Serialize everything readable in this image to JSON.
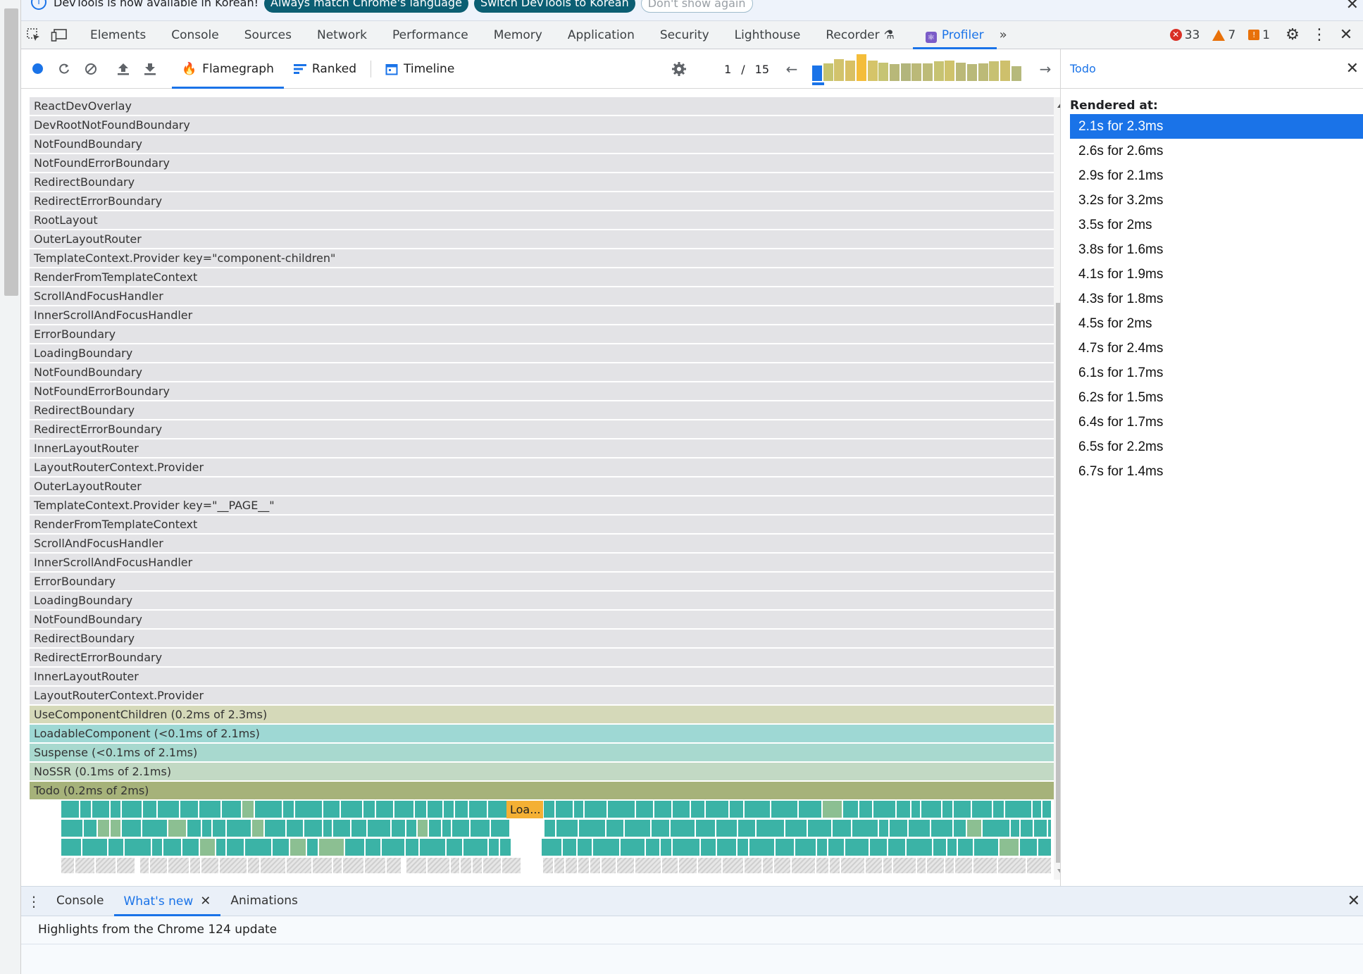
{
  "infobar": {
    "text": "DevTools is now available in Korean!",
    "match_language": "Always match Chrome's language",
    "switch_language": "Switch DevTools to Korean",
    "dont_show": "Don't show again"
  },
  "main_tabs": [
    {
      "name": "tab-elements",
      "label": "Elements"
    },
    {
      "name": "tab-console",
      "label": "Console"
    },
    {
      "name": "tab-sources",
      "label": "Sources"
    },
    {
      "name": "tab-network",
      "label": "Network"
    },
    {
      "name": "tab-performance",
      "label": "Performance"
    },
    {
      "name": "tab-memory",
      "label": "Memory"
    },
    {
      "name": "tab-application",
      "label": "Application"
    },
    {
      "name": "tab-security",
      "label": "Security"
    },
    {
      "name": "tab-lighthouse",
      "label": "Lighthouse"
    }
  ],
  "recorder_label": "Recorder",
  "profiler_label": "Profiler",
  "status": {
    "errors": "33",
    "warnings": "7",
    "issues": "1"
  },
  "profiler_tabs": {
    "flamegraph": "Flamegraph",
    "ranked": "Ranked",
    "timeline": "Timeline"
  },
  "commit": {
    "current": "1",
    "separator": "/",
    "total": "15",
    "bars": [
      {
        "level": 0.55,
        "color": "#1a73e8"
      },
      {
        "level": 0.62,
        "color": "#c6c46f"
      },
      {
        "level": 0.78,
        "color": "#d2c36c"
      },
      {
        "level": 0.72,
        "color": "#d8c064"
      },
      {
        "level": 0.95,
        "color": "#f4bd3a"
      },
      {
        "level": 0.72,
        "color": "#d5c469"
      },
      {
        "level": 0.66,
        "color": "#c6c473"
      },
      {
        "level": 0.6,
        "color": "#b8b879"
      },
      {
        "level": 0.62,
        "color": "#b2b57c"
      },
      {
        "level": 0.62,
        "color": "#bbb978"
      },
      {
        "level": 0.62,
        "color": "#bdbb78"
      },
      {
        "level": 0.7,
        "color": "#c7c372"
      },
      {
        "level": 0.72,
        "color": "#cfc36c"
      },
      {
        "level": 0.64,
        "color": "#bbb978"
      },
      {
        "level": 0.6,
        "color": "#b9b979"
      },
      {
        "level": 0.62,
        "color": "#bcba77"
      },
      {
        "level": 0.7,
        "color": "#c7c172"
      },
      {
        "level": 0.72,
        "color": "#cec06c"
      },
      {
        "level": 0.52,
        "color": "#b6b97c"
      }
    ]
  },
  "side_panel": {
    "title": "Todo",
    "rendered_at_label": "Rendered at:",
    "renders": [
      "2.1s for 2.3ms",
      "2.6s for 2.6ms",
      "2.9s for 2.1ms",
      "3.2s for 3.2ms",
      "3.5s for 2ms",
      "3.8s for 1.6ms",
      "4.1s for 1.9ms",
      "4.3s for 1.8ms",
      "4.5s for 2ms",
      "4.7s for 2.4ms",
      "6.1s for 1.7ms",
      "6.2s for 1.5ms",
      "6.4s for 1.7ms",
      "6.5s for 2.2ms",
      "6.7s for 1.4ms"
    ]
  },
  "flamegraph": {
    "rows": [
      {
        "label": "ReactDevOverlay",
        "color": "#e3e3e6"
      },
      {
        "label": "DevRootNotFoundBoundary",
        "color": "#e3e3e6"
      },
      {
        "label": "NotFoundBoundary",
        "color": "#e3e3e6"
      },
      {
        "label": "NotFoundErrorBoundary",
        "color": "#e3e3e6"
      },
      {
        "label": "RedirectBoundary",
        "color": "#e3e3e6"
      },
      {
        "label": "RedirectErrorBoundary",
        "color": "#e3e3e6"
      },
      {
        "label": "RootLayout",
        "color": "#e3e3e6"
      },
      {
        "label": "OuterLayoutRouter",
        "color": "#e3e3e6"
      },
      {
        "label": "TemplateContext.Provider key=\"component-children\"",
        "color": "#e3e3e6"
      },
      {
        "label": "RenderFromTemplateContext",
        "color": "#e3e3e6"
      },
      {
        "label": "ScrollAndFocusHandler",
        "color": "#e3e3e6"
      },
      {
        "label": "InnerScrollAndFocusHandler",
        "color": "#e3e3e6"
      },
      {
        "label": "ErrorBoundary",
        "color": "#e3e3e6"
      },
      {
        "label": "LoadingBoundary",
        "color": "#e3e3e6"
      },
      {
        "label": "NotFoundBoundary",
        "color": "#e3e3e6"
      },
      {
        "label": "NotFoundErrorBoundary",
        "color": "#e3e3e6"
      },
      {
        "label": "RedirectBoundary",
        "color": "#e3e3e6"
      },
      {
        "label": "RedirectErrorBoundary",
        "color": "#e3e3e6"
      },
      {
        "label": "InnerLayoutRouter",
        "color": "#e3e3e6"
      },
      {
        "label": "LayoutRouterContext.Provider",
        "color": "#e3e3e6"
      },
      {
        "label": "OuterLayoutRouter",
        "color": "#e3e3e6"
      },
      {
        "label": "TemplateContext.Provider key=\"__PAGE__\"",
        "color": "#e3e3e6"
      },
      {
        "label": "RenderFromTemplateContext",
        "color": "#e3e3e6"
      },
      {
        "label": "ScrollAndFocusHandler",
        "color": "#e3e3e6"
      },
      {
        "label": "InnerScrollAndFocusHandler",
        "color": "#e3e3e6"
      },
      {
        "label": "ErrorBoundary",
        "color": "#e3e3e6"
      },
      {
        "label": "LoadingBoundary",
        "color": "#e3e3e6"
      },
      {
        "label": "NotFoundBoundary",
        "color": "#e3e3e6"
      },
      {
        "label": "RedirectBoundary",
        "color": "#e3e3e6"
      },
      {
        "label": "RedirectErrorBoundary",
        "color": "#e3e3e6"
      },
      {
        "label": "InnerLayoutRouter",
        "color": "#e3e3e6"
      },
      {
        "label": "LayoutRouterContext.Provider",
        "color": "#e3e3e6"
      },
      {
        "label": "UseComponentChildren (0.2ms of 2.3ms)",
        "color": "#d5d9b9"
      },
      {
        "label": "LoadableComponent (<0.1ms of 2.1ms)",
        "color": "#9ed8d4"
      },
      {
        "label": "Suspense (<0.1ms of 2.1ms)",
        "color": "#a8d9cf"
      },
      {
        "label": "NoSSR (0.1ms of 2.1ms)",
        "color": "#c2d9c4"
      },
      {
        "label": "Todo (0.2ms of 2ms)",
        "color": "#a6b27a"
      }
    ],
    "truncated_child_label": "Loa...",
    "truncated_child_color": "#f4b034",
    "cell_color": "#3bb3a6",
    "cell_alt_color": "#8cbf92",
    "hatched_color": "#d8d8d8"
  },
  "drawer": {
    "tabs": [
      "Console",
      "What's new",
      "Animations"
    ],
    "highlight": "Highlights from the Chrome 124 update"
  }
}
